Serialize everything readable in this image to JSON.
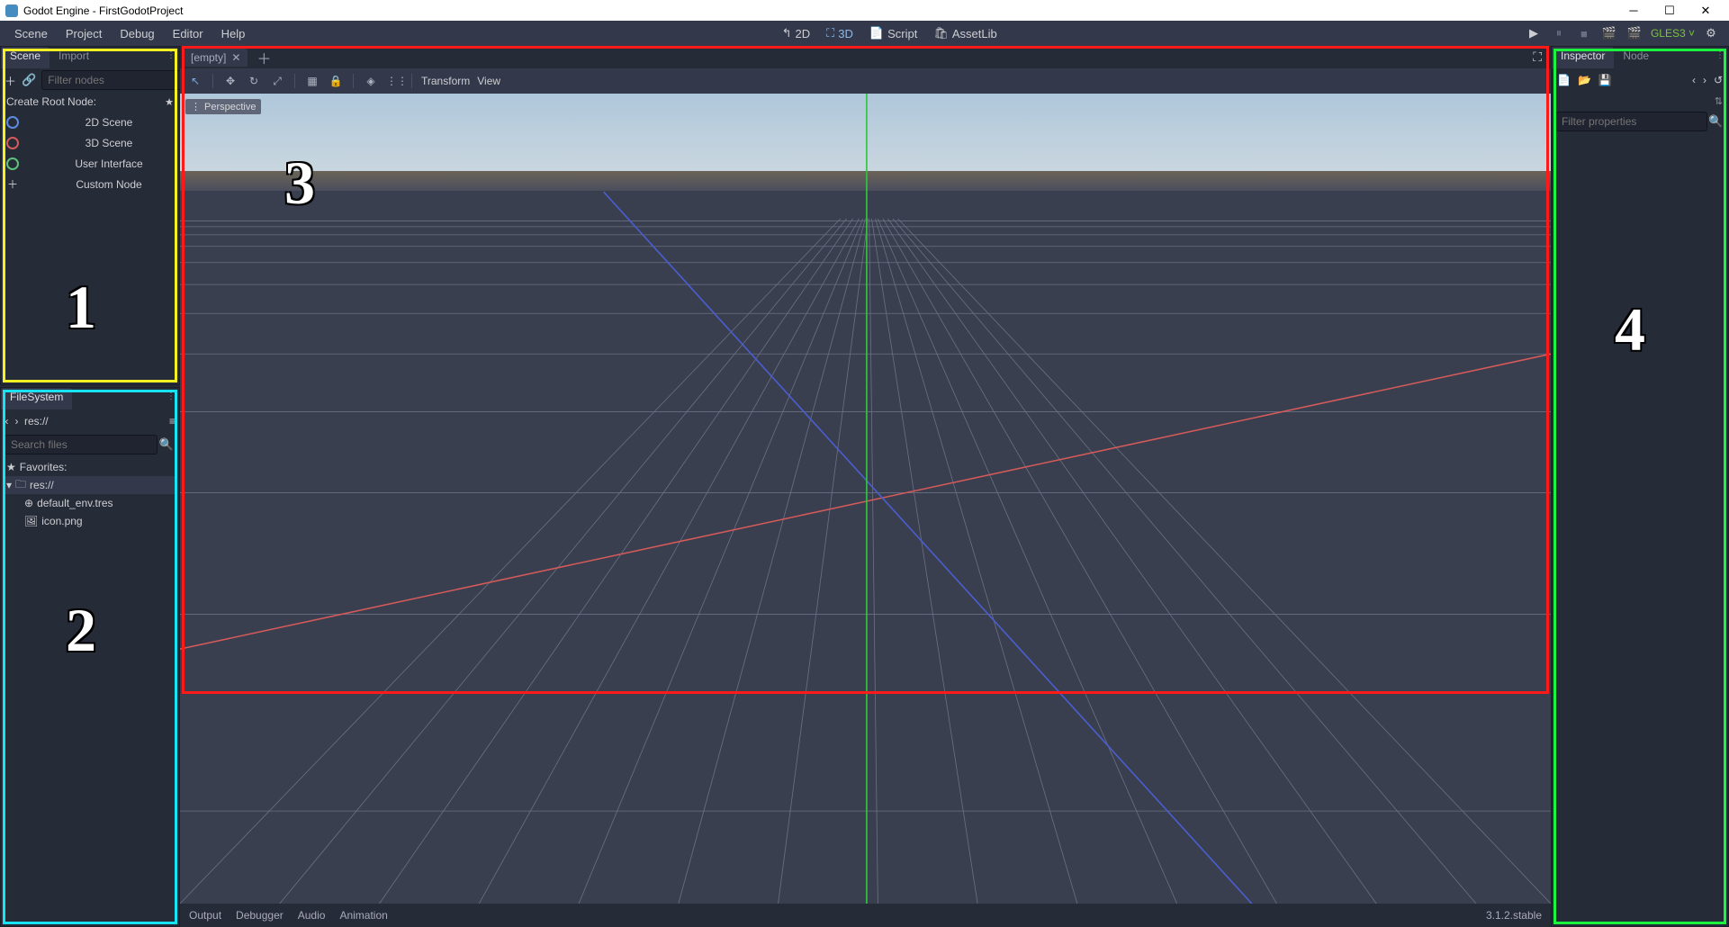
{
  "window": {
    "title": "Godot Engine - FirstGodotProject"
  },
  "menubar": {
    "items": [
      "Scene",
      "Project",
      "Debug",
      "Editor",
      "Help"
    ],
    "modes": {
      "2d": "2D",
      "3d": "3D",
      "script": "Script",
      "assetlib": "AssetLib"
    },
    "renderer": "GLES3"
  },
  "scene_dock": {
    "tabs": {
      "scene": "Scene",
      "import": "Import"
    },
    "filter_placeholder": "Filter nodes",
    "create_label": "Create Root Node:",
    "roots": {
      "2d": "2D Scene",
      "3d": "3D Scene",
      "ui": "User Interface",
      "custom": "Custom Node"
    }
  },
  "filesystem_dock": {
    "title": "FileSystem",
    "path": "res://",
    "search_placeholder": "Search files",
    "favorites_label": "Favorites:",
    "root": "res://",
    "files": [
      "default_env.tres",
      "icon.png"
    ]
  },
  "viewport": {
    "tab": "[empty]",
    "toolbar": {
      "transform": "Transform",
      "view": "View"
    },
    "perspective": "Perspective"
  },
  "inspector_dock": {
    "tabs": {
      "inspector": "Inspector",
      "node": "Node"
    },
    "filter_placeholder": "Filter properties"
  },
  "bottom_bar": {
    "tabs": [
      "Output",
      "Debugger",
      "Audio",
      "Animation"
    ],
    "version": "3.1.2.stable"
  },
  "annotations": {
    "a1": "1",
    "a2": "2",
    "a3": "3",
    "a4": "4"
  }
}
